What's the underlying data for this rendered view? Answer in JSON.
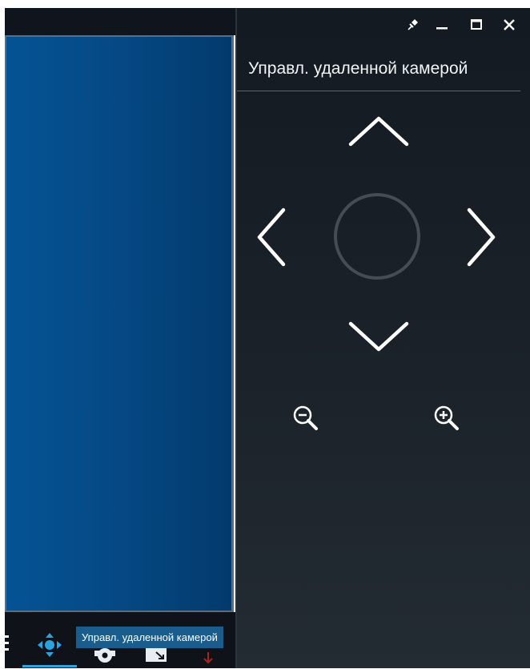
{
  "panel": {
    "title": "Управл. удаленной камерой",
    "window_controls": [
      "pin-icon",
      "minimize-icon",
      "maximize-icon",
      "close-icon"
    ]
  },
  "ptz_controls": {
    "buttons": [
      "pan-up",
      "pan-left",
      "center-home",
      "pan-right",
      "pan-down",
      "zoom-out",
      "zoom-in"
    ]
  },
  "toolbar": {
    "tooltip": "Управл. удаленной камерой",
    "icons": [
      "grid-icon",
      "ptz-move-icon",
      "settings-gear-icon",
      "fullscreen-icon",
      "download-icon"
    ],
    "active": "ptz-move-icon"
  },
  "colors": {
    "video_blue": "#055394",
    "panel_bg": "#1a2129",
    "accent": "#2aa3df",
    "tooltip_bg": "#1a5d8d"
  }
}
